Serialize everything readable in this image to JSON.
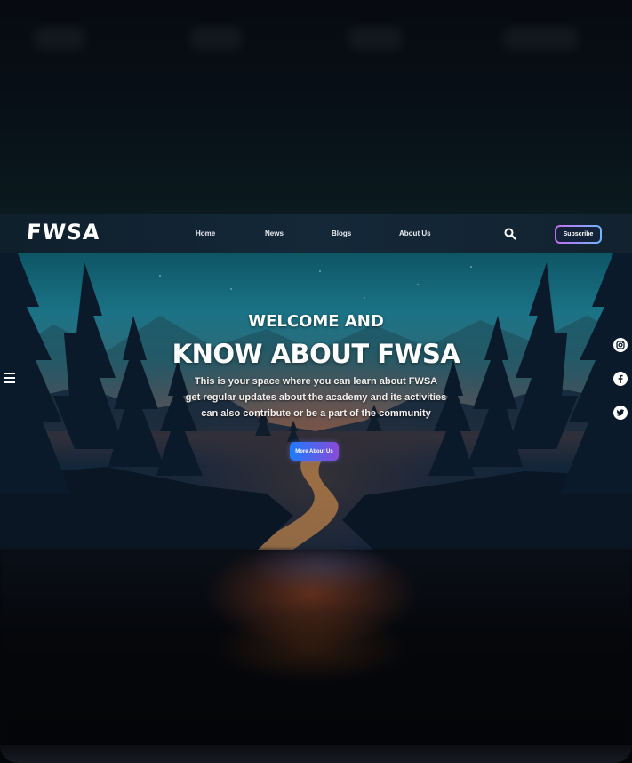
{
  "navbar": {
    "logo": "FWSA",
    "links": [
      "Home",
      "News",
      "Blogs",
      "About Us"
    ],
    "subscribe_label": "Subscribe"
  },
  "hero": {
    "title_line_1": "WELCOME AND",
    "title_line_2": "KNOW ABOUT FWSA",
    "text_lines": [
      "This is your space where you can learn about FWSA",
      "get regular updates about the academy and its activities",
      "can also contribute or be a part of the community"
    ],
    "button_label": "More About Us"
  },
  "icons": {
    "search": "search-icon",
    "menu": "hamburger-menu-icon",
    "social": [
      "instagram-icon",
      "facebook-icon",
      "twitter-icon"
    ]
  },
  "colors": {
    "subscribe_gradient": [
      "#c56cf0",
      "#6fb7ff"
    ],
    "button_gradient": [
      "#1d7bff",
      "#8a4ad8"
    ],
    "nav_background": "#142839"
  }
}
